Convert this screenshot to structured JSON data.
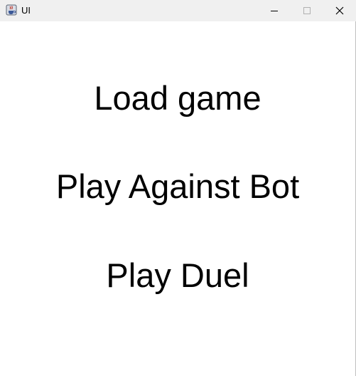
{
  "window": {
    "title": "UI",
    "icon": "java-cup-icon",
    "controls": {
      "minimize": "minimize-icon",
      "maximize": "maximize-icon",
      "close": "close-icon"
    }
  },
  "menu": {
    "items": [
      {
        "label": "Load game"
      },
      {
        "label": "Play Against Bot"
      },
      {
        "label": "Play Duel"
      }
    ]
  }
}
